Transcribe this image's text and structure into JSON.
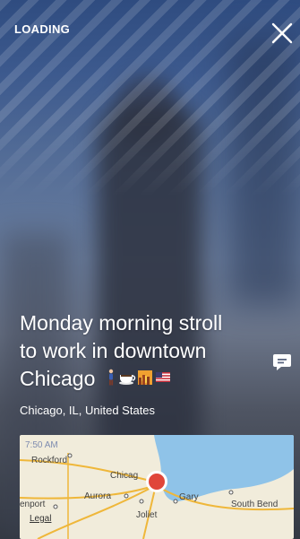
{
  "status": {
    "loading_label": "LOADING"
  },
  "caption": {
    "line1": "Monday morning stroll",
    "line2": "to work in downtown",
    "line3": "Chicago",
    "location": "Chicago, IL, United States"
  },
  "icons": {
    "close": "close-icon",
    "comment": "comment-icon",
    "emojis": [
      "person-walking-icon",
      "coffee-cup-icon",
      "city-sunset-icon",
      "us-flag-icon"
    ]
  },
  "map": {
    "time": "7:50 AM",
    "labels": {
      "rockford": "Rockford",
      "chicago": "Chicag",
      "aurora": "Aurora",
      "davenport": "enport",
      "gary": "Gary",
      "south_bend": "South Bend",
      "joliet": "Joliet",
      "legal": "Legal"
    }
  },
  "colors": {
    "marker": "#e0463a",
    "lake": "#8fc3e8",
    "map_land": "#f1ecdb",
    "road": "#efb73a"
  }
}
